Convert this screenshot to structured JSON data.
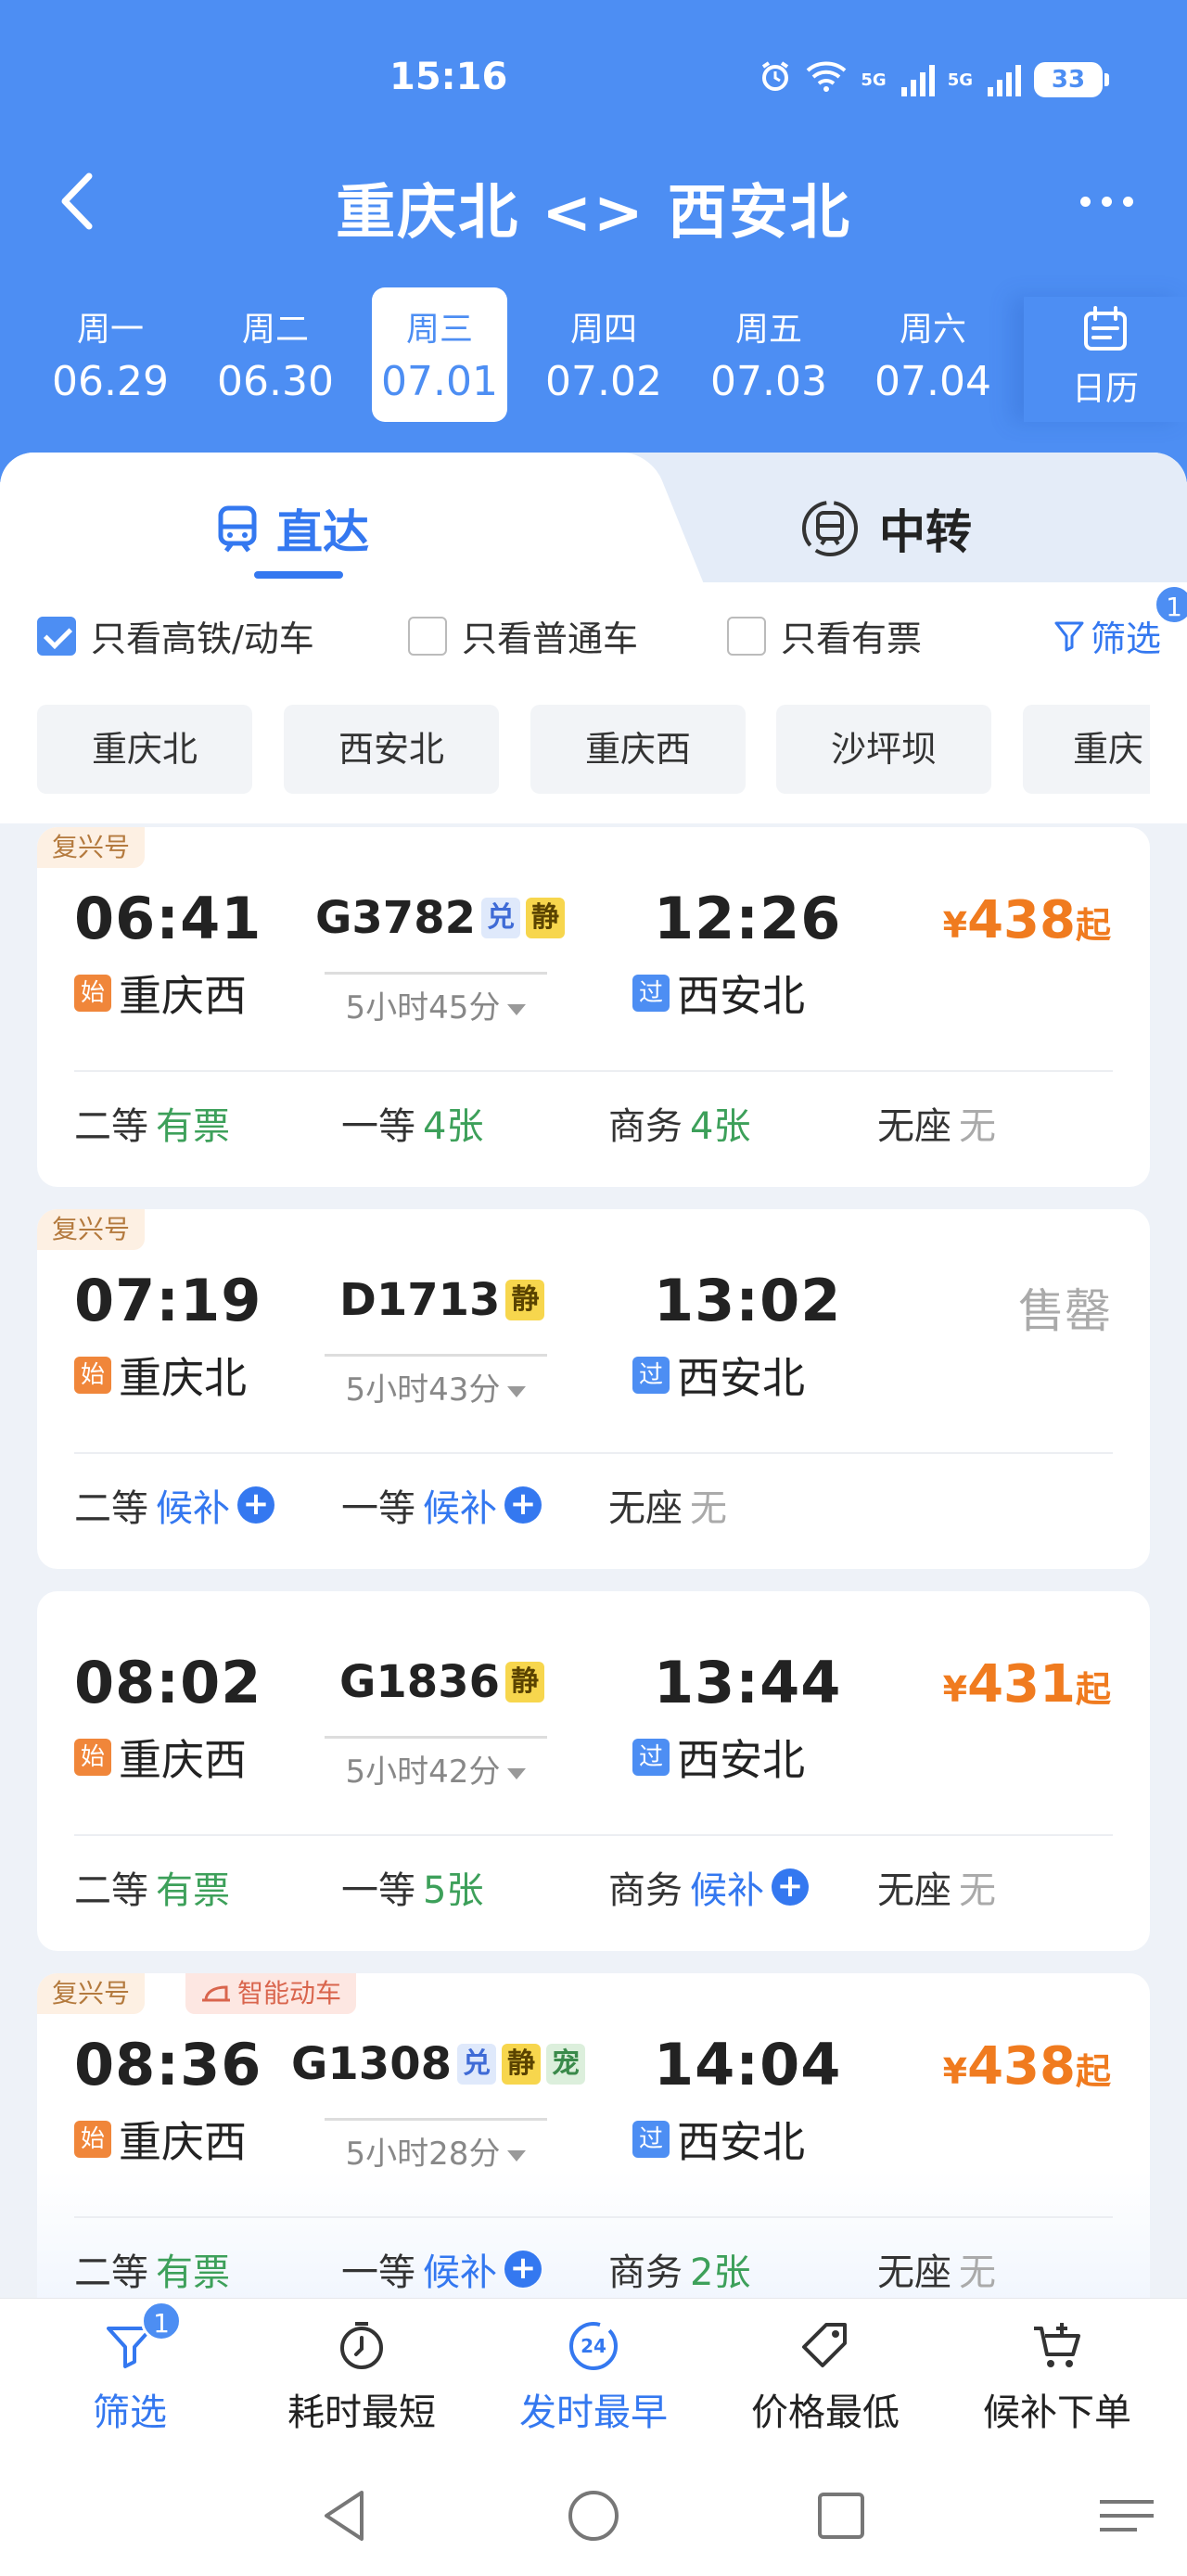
{
  "status_bar": {
    "time": "15:16",
    "battery": "33",
    "network_1": "5G",
    "network_2": "5G",
    "wifi_label": "6"
  },
  "header": {
    "title": "重庆北 <> 西安北"
  },
  "dates": [
    {
      "weekday": "周一",
      "date": "06.29",
      "active": false
    },
    {
      "weekday": "周二",
      "date": "06.30",
      "active": false
    },
    {
      "weekday": "周三",
      "date": "07.01",
      "active": true
    },
    {
      "weekday": "周四",
      "date": "07.02",
      "active": false
    },
    {
      "weekday": "周五",
      "date": "07.03",
      "active": false
    },
    {
      "weekday": "周六",
      "date": "07.04",
      "active": false
    }
  ],
  "calendar_label": "日历",
  "tabs": {
    "direct": "直达",
    "transfer": "中转"
  },
  "filters": {
    "only_high_speed": "只看高铁/动车",
    "only_regular": "只看普通车",
    "only_available": "只看有票",
    "filter_label": "筛选",
    "filter_badge": "1"
  },
  "stations": [
    "重庆北",
    "西安北",
    "重庆西",
    "沙坪坝",
    "重庆"
  ],
  "trains": [
    {
      "tag": "复兴号",
      "smart_tag": "",
      "dep_time": "06:41",
      "arr_time": "12:26",
      "train_no": "G3782",
      "chips": [
        "兑",
        "静"
      ],
      "duration": "5小时45分",
      "dep_station": "重庆西",
      "dep_mark": "始",
      "arr_station": "西安北",
      "arr_mark": "过",
      "price_currency": "¥",
      "price": "438",
      "price_suffix": "起",
      "sold_out": "",
      "seats": [
        {
          "class": "二等",
          "value": "有票",
          "kind": "green"
        },
        {
          "class": "一等",
          "value": "4张",
          "kind": "green"
        },
        {
          "class": "商务",
          "value": "4张",
          "kind": "green"
        },
        {
          "class": "无座",
          "value": "无",
          "kind": "gray"
        }
      ]
    },
    {
      "tag": "复兴号",
      "smart_tag": "",
      "dep_time": "07:19",
      "arr_time": "13:02",
      "train_no": "D1713",
      "chips": [
        "静"
      ],
      "duration": "5小时43分",
      "dep_station": "重庆北",
      "dep_mark": "始",
      "arr_station": "西安北",
      "arr_mark": "过",
      "price_currency": "",
      "price": "",
      "price_suffix": "",
      "sold_out": "售罄",
      "seats": [
        {
          "class": "二等",
          "value": "候补",
          "kind": "blue"
        },
        {
          "class": "一等",
          "value": "候补",
          "kind": "blue"
        },
        {
          "class": "无座",
          "value": "无",
          "kind": "gray"
        }
      ]
    },
    {
      "tag": "",
      "smart_tag": "",
      "dep_time": "08:02",
      "arr_time": "13:44",
      "train_no": "G1836",
      "chips": [
        "静"
      ],
      "duration": "5小时42分",
      "dep_station": "重庆西",
      "dep_mark": "始",
      "arr_station": "西安北",
      "arr_mark": "过",
      "price_currency": "¥",
      "price": "431",
      "price_suffix": "起",
      "sold_out": "",
      "seats": [
        {
          "class": "二等",
          "value": "有票",
          "kind": "green"
        },
        {
          "class": "一等",
          "value": "5张",
          "kind": "green"
        },
        {
          "class": "商务",
          "value": "候补",
          "kind": "blue"
        },
        {
          "class": "无座",
          "value": "无",
          "kind": "gray"
        }
      ]
    },
    {
      "tag": "复兴号",
      "smart_tag": "智能动车",
      "dep_time": "08:36",
      "arr_time": "14:04",
      "train_no": "G1308",
      "chips": [
        "兑",
        "静",
        "宠"
      ],
      "duration": "5小时28分",
      "dep_station": "重庆西",
      "dep_mark": "始",
      "arr_station": "西安北",
      "arr_mark": "过",
      "price_currency": "¥",
      "price": "438",
      "price_suffix": "起",
      "sold_out": "",
      "seats": [
        {
          "class": "二等",
          "value": "有票",
          "kind": "green"
        },
        {
          "class": "一等",
          "value": "候补",
          "kind": "blue"
        },
        {
          "class": "商务",
          "value": "2张",
          "kind": "green"
        },
        {
          "class": "无座",
          "value": "无",
          "kind": "gray"
        }
      ]
    }
  ],
  "bottom_bar": {
    "filter": "筛选",
    "filter_badge": "1",
    "shortest": "耗时最短",
    "earliest": "发时最早",
    "earliest_icon_text": "24",
    "cheapest": "价格最低",
    "waitlist": "候补下单"
  },
  "colors": {
    "brand_blue": "#4d8ef3",
    "price_orange": "#f07b1f",
    "available_green": "#3da05a",
    "link_blue": "#3478f0"
  }
}
